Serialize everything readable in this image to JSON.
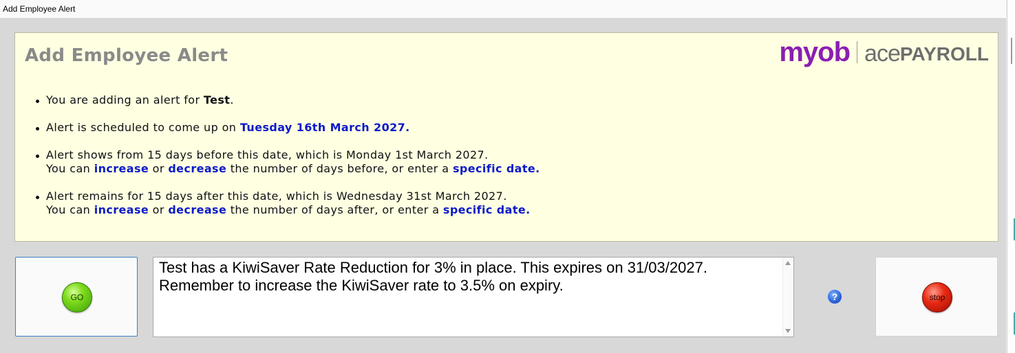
{
  "window": {
    "title": "Add Employee Alert"
  },
  "panel": {
    "heading": "Add Employee Alert",
    "logo": {
      "myob": "myob",
      "ace": "ace",
      "payroll": "PAYROLL"
    },
    "bullet1": {
      "pre": "You are adding an alert for ",
      "employee": "Test",
      "post": "."
    },
    "bullet2": {
      "pre": "Alert is scheduled to come up on ",
      "date": "Tuesday 16th March 2027."
    },
    "bullet3": {
      "line1": "Alert shows from 15 days before this date, which is Monday 1st March 2027.",
      "you_can": "You can ",
      "increase": "increase",
      "or": " or ",
      "decrease": "decrease",
      "mid": " the number of days before, or enter a ",
      "specific": "specific date."
    },
    "bullet4": {
      "line1": "Alert remains for 15 days after this date, which is Wednesday 31st March 2027.",
      "you_can": "You can ",
      "increase": "increase",
      "or": " or ",
      "decrease": "decrease",
      "mid": " the number of days after, or enter a ",
      "specific": "specific date."
    }
  },
  "buttons": {
    "go": "GO",
    "help": "?",
    "stop": "stop"
  },
  "message": {
    "text": "Test has a KiwiSaver Rate Reduction for 3% in place. This expires on 31/03/2027.\nRemember to increase the KiwiSaver rate to 3.5% on expiry."
  },
  "colors": {
    "panel_bg": "#ffffe2",
    "link": "#0b1ac9",
    "heading": "#8a8a8a",
    "myob_purple": "#8a1fb3",
    "go_green": "#7fdc1d",
    "stop_red": "#e82a14"
  }
}
